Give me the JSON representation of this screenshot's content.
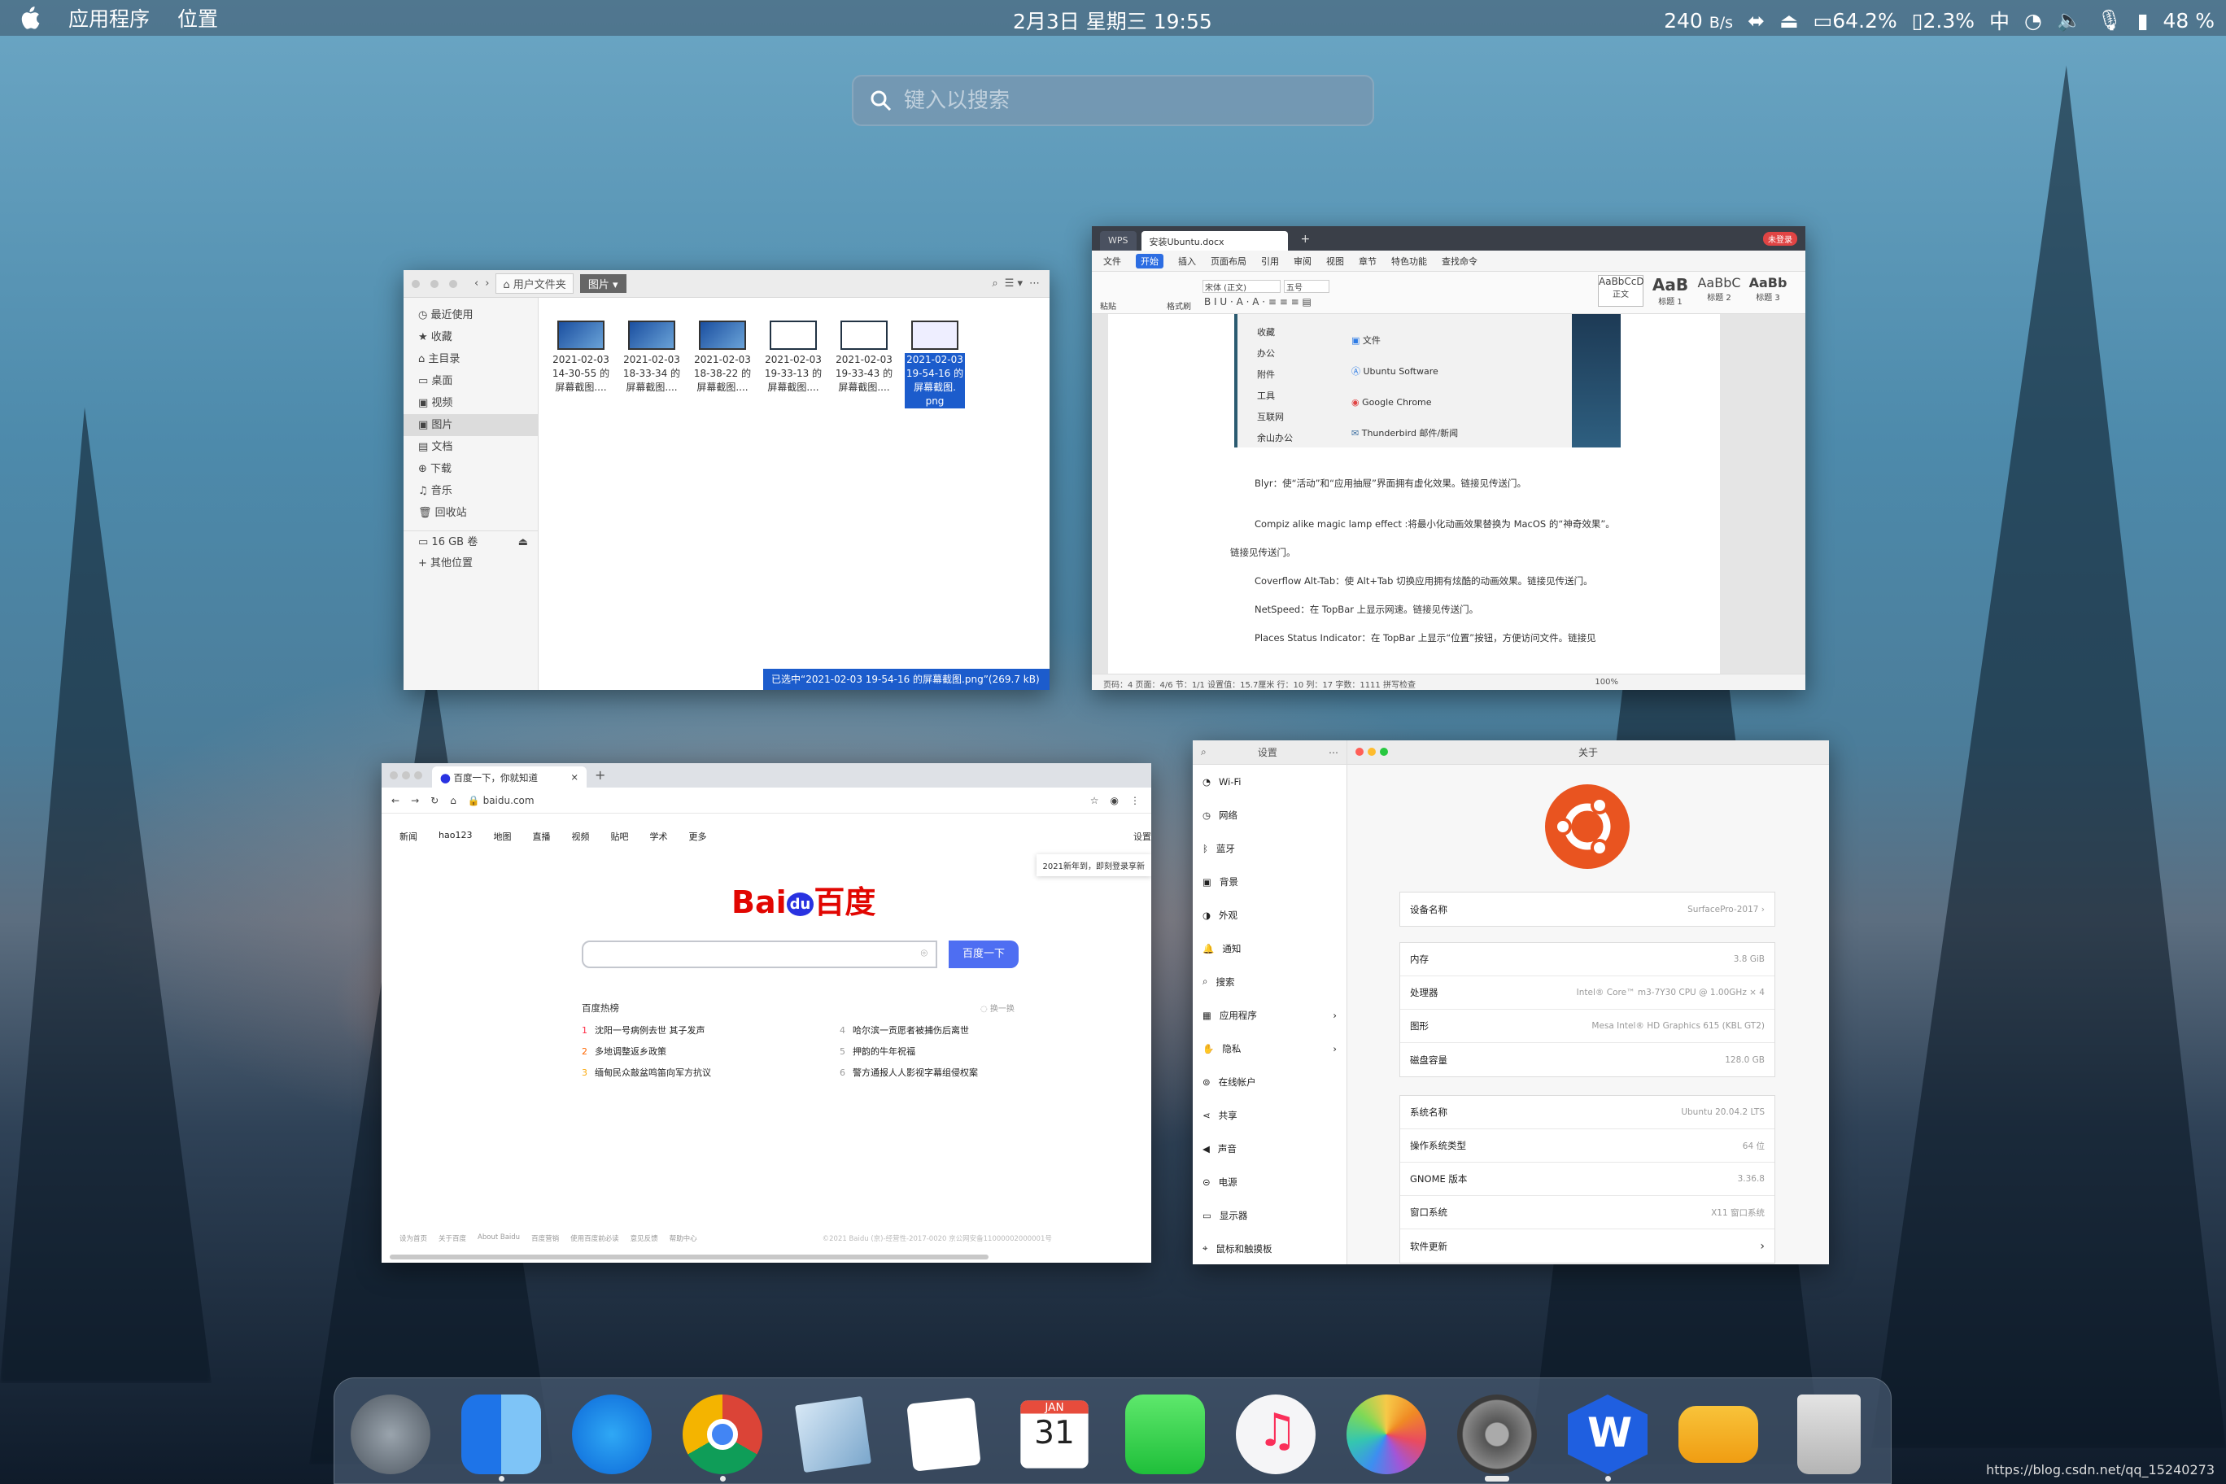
{
  "topbar": {
    "apps": "应用程序",
    "places": "位置",
    "datetime": "2月3日 星期三  19:55",
    "net_speed": "240",
    "net_unit": "B/s",
    "cpu": "64.2%",
    "mem": "2.3%",
    "ime": "中",
    "battery": "48 %"
  },
  "search": {
    "placeholder": "键入以搜索"
  },
  "files": {
    "path_home": "用户文件夹",
    "path_current": "图片",
    "sidebar": [
      "最近使用",
      "收藏",
      "主目录",
      "桌面",
      "视频",
      "图片",
      "文档",
      "下载",
      "音乐",
      "回收站"
    ],
    "volume": "16 GB 卷",
    "other": "其他位置",
    "items": [
      {
        "l1": "2021-02-03",
        "l2": "14-30-55 的",
        "l3": "屏幕截图...."
      },
      {
        "l1": "2021-02-03",
        "l2": "18-33-34 的",
        "l3": "屏幕截图...."
      },
      {
        "l1": "2021-02-03",
        "l2": "18-38-22 的",
        "l3": "屏幕截图...."
      },
      {
        "l1": "2021-02-03",
        "l2": "19-33-13 的",
        "l3": "屏幕截图...."
      },
      {
        "l1": "2021-02-03",
        "l2": "19-33-43 的",
        "l3": "屏幕截图...."
      },
      {
        "l1": "2021-02-03",
        "l2": "19-54-16 的",
        "l3": "屏幕截图.",
        "l4": "png"
      }
    ],
    "status": "已选中“2021-02-03 19-54-16 的屏幕截图.png”(269.7 kB)"
  },
  "wps": {
    "tab_app": "WPS",
    "tab_doc": "安装Ubuntu.docx",
    "login": "未登录",
    "menu": [
      "文件",
      "开始",
      "插入",
      "页面布局",
      "引用",
      "审阅",
      "视图",
      "章节",
      "特色功能",
      "查找命令"
    ],
    "font": "宋体 (正文)",
    "size": "五号",
    "paste": "粘贴",
    "brush": "格式刷",
    "styles": [
      {
        "big": "AaBbCcD",
        "small": "正文"
      },
      {
        "big": "AaB",
        "small": "标题 1"
      },
      {
        "big": "AaBbC",
        "small": "标题 2"
      },
      {
        "big": "AaBb",
        "small": "标题 3"
      }
    ],
    "menu_cats": [
      "收藏",
      "办公",
      "附件",
      "工具",
      "互联网",
      "余山办公"
    ],
    "menu_apps": [
      "文件",
      "Ubuntu Software",
      "Google Chrome",
      "Thunderbird 邮件/新闻"
    ],
    "paras": [
      "Blyr：使“活动”和“应用抽屉”界面拥有虚化效果。链接见传送门。",
      "Compiz alike magic lamp effect :将最小化动画效果替换为 MacOS 的“神奇效果”。",
      "链接见传送门。",
      "Coverflow Alt-Tab：使 Alt+Tab 切换应用拥有炫酷的动画效果。链接见传送门。",
      "NetSpeed：在 TopBar 上显示网速。链接见传送门。",
      "Places Status Indicator：在 TopBar 上显示“位置”按钮，方便访问文件。链接见"
    ],
    "status": "页码：4   页面：4/6   节：1/1   设置值：15.7厘米   行：10   列：17   字数：1111   拼写检查",
    "zoom": "100%"
  },
  "baidu": {
    "tab": "百度一下，你就知道",
    "url": "baidu.com",
    "navs": [
      "新闻",
      "hao123",
      "地图",
      "直播",
      "视频",
      "贴吧",
      "学术",
      "更多"
    ],
    "settings": "设置",
    "notice": "2021新年到，即刻登录享新",
    "logo": "Bai  百度",
    "logo_du": "du",
    "button": "百度一下",
    "hot_title": "百度热榜",
    "refresh": "换一换",
    "hot": [
      {
        "n": "1",
        "t": "沈阳一号病例去世 其子发声"
      },
      {
        "n": "4",
        "t": "哈尔滨一贡愿者被捕伤后离世"
      },
      {
        "n": "2",
        "t": "多地调整返乡政策"
      },
      {
        "n": "5",
        "t": "押韵的牛年祝福"
      },
      {
        "n": "3",
        "t": "缅甸民众敲盆鸣笛向军方抗议"
      },
      {
        "n": "6",
        "t": "警方通报人人影视字幕组侵权案"
      }
    ],
    "footer": [
      "设为首页",
      "关于百度",
      "About Baidu",
      "百度营销",
      "使用百度前必读",
      "意见反馈",
      "帮助中心"
    ],
    "copyright": "©2021 Baidu  (京)-经营性-2017-0020  京公网安备11000002000001号"
  },
  "settings": {
    "title": "设置",
    "about": "关于",
    "items": [
      "Wi-Fi",
      "网络",
      "蓝牙",
      "背景",
      "外观",
      "通知",
      "搜索",
      "应用程序",
      "隐私",
      "在线帐户",
      "共享",
      "声音",
      "电源",
      "显示器",
      "鼠标和触摸板"
    ],
    "device": {
      "label": "设备名称",
      "value": "SurfacePro-2017"
    },
    "hw": [
      {
        "k": "内存",
        "v": "3.8 GiB"
      },
      {
        "k": "处理器",
        "v": "Intel® Core™ m3-7Y30 CPU @ 1.00GHz × 4"
      },
      {
        "k": "图形",
        "v": "Mesa Intel® HD Graphics 615 (KBL GT2)"
      },
      {
        "k": "磁盘容量",
        "v": "128.0 GB"
      }
    ],
    "os": [
      {
        "k": "系统名称",
        "v": "Ubuntu 20.04.2 LTS"
      },
      {
        "k": "操作系统类型",
        "v": "64 位"
      },
      {
        "k": "GNOME 版本",
        "v": "3.36.8"
      },
      {
        "k": "窗口系统",
        "v": "X11 窗口系统"
      },
      {
        "k": "软件更新",
        "v": "›"
      }
    ]
  },
  "dock": {
    "calendar_month": "JAN",
    "calendar_day": "31",
    "apps": [
      "launchpad",
      "finder",
      "app-store",
      "chrome",
      "mail",
      "reminders",
      "calendar",
      "facetime",
      "music",
      "photos",
      "settings",
      "wps",
      "drive",
      "trash"
    ]
  },
  "watermark": "https://blog.csdn.net/qq_15240273"
}
